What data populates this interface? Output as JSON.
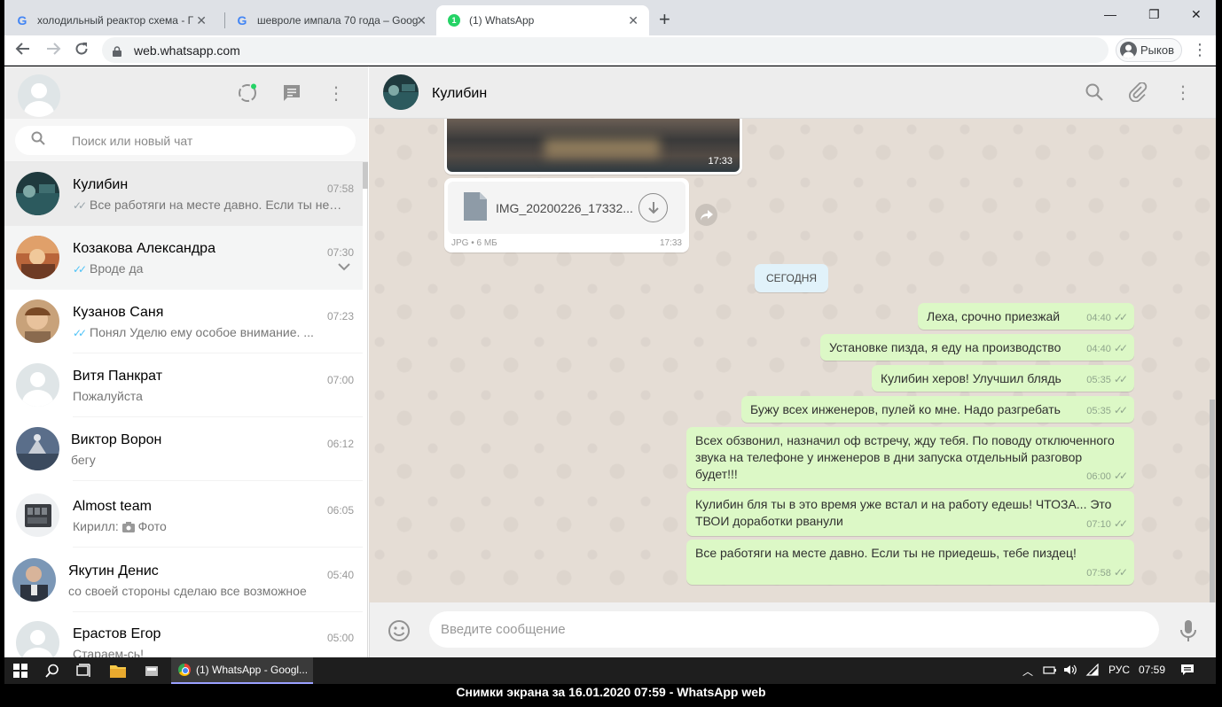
{
  "browser": {
    "tabs": [
      {
        "title": "холодильный реактор схема - Г"
      },
      {
        "title": "шевроле импала 70 года – Goog"
      },
      {
        "title": "(1) WhatsApp",
        "badge": "1"
      }
    ],
    "url": "web.whatsapp.com",
    "profile_name": "Рыков"
  },
  "sidebar": {
    "search_placeholder": "Поиск или новый чат",
    "chats": [
      {
        "name": "Кулибин",
        "time": "07:58",
        "preview": "Все работяги на месте давно. Если ты не п..."
      },
      {
        "name": "Козакова Александра",
        "time": "07:30",
        "preview": "Вроде да"
      },
      {
        "name": "Кузанов Саня",
        "time": "07:23",
        "preview": "Понял    Уделю ему особое внимание. ..."
      },
      {
        "name": "Витя Панкрат",
        "time": "07:00",
        "preview": "Пожалуйста"
      },
      {
        "name": "Виктор Ворон",
        "time": "06:12",
        "preview": "бегу"
      },
      {
        "name": "Almost team",
        "time": "06:05",
        "preview_sender": "Кирилл:",
        "preview": "Фото"
      },
      {
        "name": "Якутин Денис",
        "time": "05:40",
        "preview": "со своей стороны сделаю все возможное"
      },
      {
        "name": "Ерастов Егор",
        "time": "05:00",
        "preview": "Стараем-сь!"
      }
    ]
  },
  "conversation": {
    "contact_name": "Кулибин",
    "image_time": "17:33",
    "document": {
      "name": "IMG_20200226_17332...",
      "meta": "JPG • 6 МБ",
      "time": "17:33"
    },
    "date_chip": "СЕГОДНЯ",
    "messages": [
      {
        "text": "Леха, срочно приезжай",
        "time": "04:40"
      },
      {
        "text": "Установке пизда, я еду на производство",
        "time": "04:40"
      },
      {
        "text": "Кулибин херов! Улучшил блядь",
        "time": "05:35"
      },
      {
        "text": "Бужу всех инженеров, пулей ко мне. Надо разгребать",
        "time": "05:35"
      },
      {
        "text": "Всех обзвонил, назначил оф встречу, жду тебя. По поводу отключенного звука на телефоне у инженеров в дни запуска отдельный разговор будет!!!",
        "time": "06:00"
      },
      {
        "text": "Кулибин бля ты в это время уже встал и на работу едешь! ЧТОЗА... Это ТВОИ доработки рванули",
        "time": "07:10"
      },
      {
        "text": "Все работяги на месте давно. Если ты не приедешь, тебе пиздец!",
        "time": "07:58"
      }
    ],
    "input_placeholder": "Введите сообщение"
  },
  "taskbar": {
    "active_window": "(1) WhatsApp - Googl...",
    "language": "РУС",
    "clock": "07:59"
  },
  "caption": "Снимки экрана за 16.01.2020 07:59 - WhatsApp web",
  "colors": {
    "outgoing_bubble": "#dcf8c6",
    "chat_bg": "#e5ddd5",
    "panel_header": "#ededed",
    "read_tick": "#4fc3f7",
    "online_dot": "#25d366"
  }
}
